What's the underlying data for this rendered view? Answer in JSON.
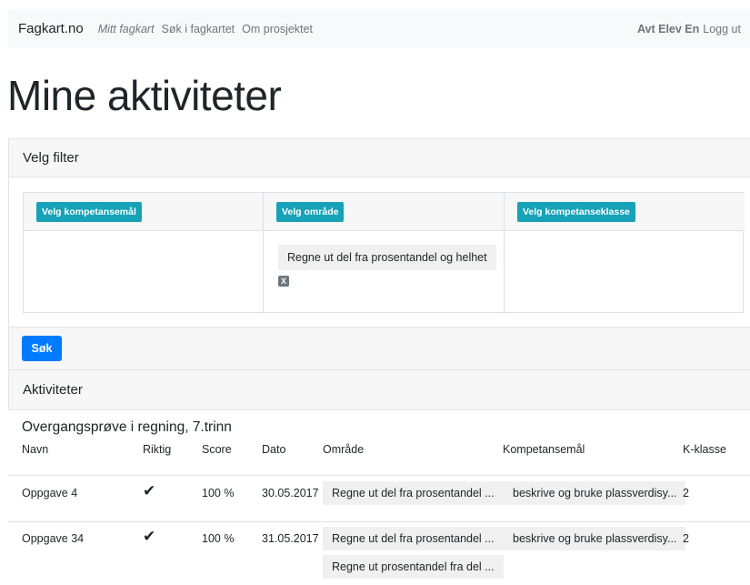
{
  "nav": {
    "brand": "Fagkart.no",
    "links": [
      "Mitt fagkart",
      "Søk i fagkartet",
      "Om prosjektet"
    ],
    "user": "Avt Elev En",
    "logout": "Logg ut"
  },
  "page_title": "Mine aktiviteter",
  "filter": {
    "header": "Velg filter",
    "columns": [
      {
        "button": "Velg kompetansemål"
      },
      {
        "button": "Velg område"
      },
      {
        "button": "Velg kompetanseklasse"
      }
    ],
    "selected_area": "Regne ut del fra prosentandel og helhet",
    "remove_glyph": "X",
    "search_button": "Søk"
  },
  "activities": {
    "header": "Aktiviteter",
    "test_title": "Overgangsprøve i regning, 7.trinn",
    "columns": [
      "Navn",
      "Riktig",
      "Score",
      "Dato",
      "Område",
      "Kompetansemål",
      "K-klasse"
    ],
    "rows": [
      {
        "name": "Oppgave 4",
        "correct_icon": "✔",
        "score": "100 %",
        "date": "30.05.2017",
        "areas": [
          "Regne ut del fra prosentandel ..."
        ],
        "goal": "beskrive og bruke plassverdisy...",
        "kclass": "2"
      },
      {
        "name": "Oppgave 34",
        "correct_icon": "✔",
        "score": "100 %",
        "date": "31.05.2017",
        "areas": [
          "Regne ut del fra prosentandel ...",
          "Regne ut prosentandel fra del ..."
        ],
        "goal": "beskrive og bruke plassverdisy...",
        "kclass": "2"
      }
    ]
  }
}
